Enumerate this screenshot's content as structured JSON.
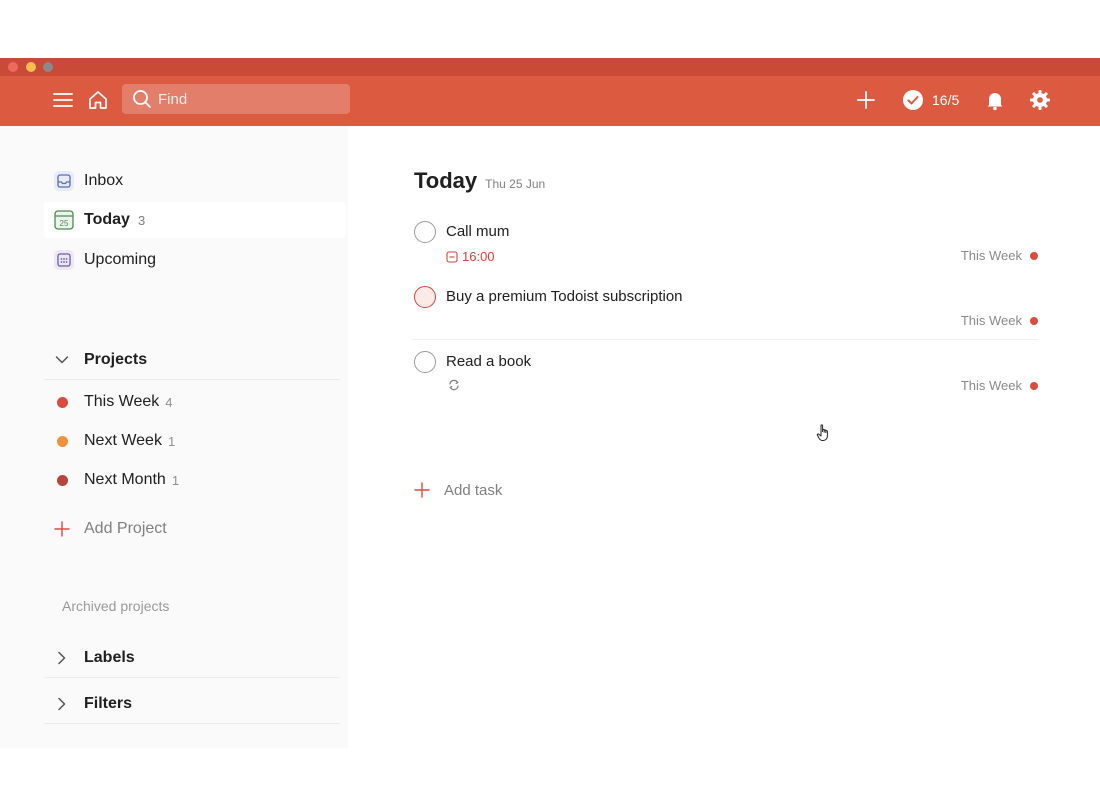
{
  "colors": {
    "brand": "#db5a40",
    "titlebar": "#c94b37",
    "accent": "#d1453b",
    "this_week": "#db4c3f",
    "next_week": "#f0923a",
    "next_month": "#b8443a"
  },
  "topbar": {
    "search_placeholder": "Find",
    "karma": "16/5",
    "icons": [
      "menu-icon",
      "home-icon",
      "search-icon",
      "plus-icon",
      "karma-check-icon",
      "bell-icon",
      "gear-icon"
    ]
  },
  "sidebar": {
    "inbox": {
      "label": "Inbox"
    },
    "today": {
      "label": "Today",
      "count": "3"
    },
    "upcoming": {
      "label": "Upcoming"
    },
    "projects_header": "Projects",
    "projects": [
      {
        "label": "This Week",
        "count": "4",
        "color": "#db4c3f"
      },
      {
        "label": "Next Week",
        "count": "1",
        "color": "#f0923a"
      },
      {
        "label": "Next Month",
        "count": "1",
        "color": "#b8443a"
      }
    ],
    "add_project": "Add Project",
    "archived": "Archived projects",
    "labels_header": "Labels",
    "filters_header": "Filters"
  },
  "main": {
    "title": "Today",
    "date": "Thu 25 Jun",
    "tasks": [
      {
        "title": "Call mum",
        "time": "16:00",
        "project": "This Week"
      },
      {
        "title": "Buy a premium Todoist subscription",
        "project": "This Week"
      },
      {
        "title": "Read a book",
        "project": "This Week"
      }
    ],
    "add_task": "Add task"
  }
}
